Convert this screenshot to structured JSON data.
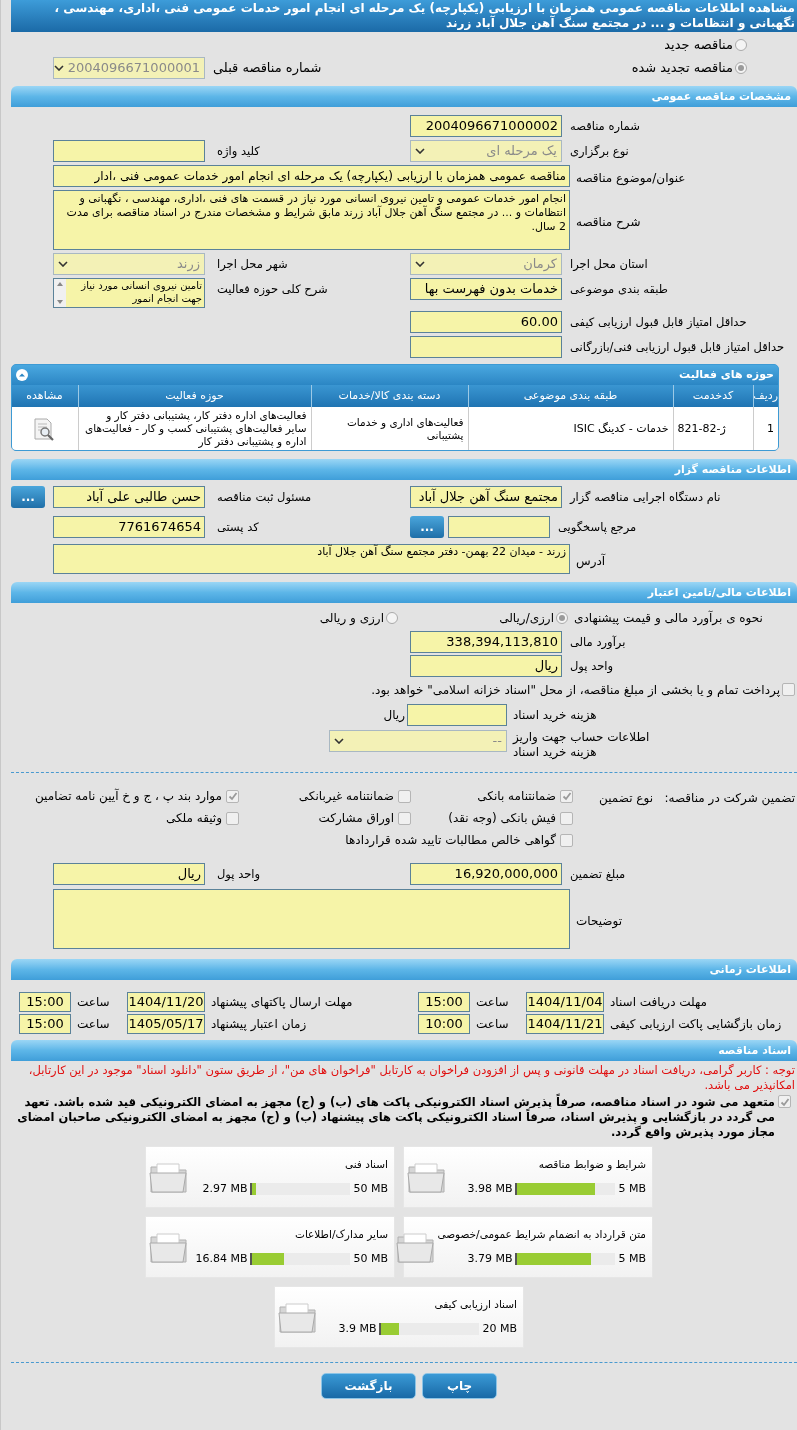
{
  "title": "مشاهده اطلاعات مناقصه عمومی همزمان با ارزیابی (یکپارچه) یک مرحله ای انجام امور خدمات عمومی فنی ،اداری، مهندسی ، نگهبانی و انتظامات و ... در مجتمع سنگ آهن جلال آباد زرند",
  "tender_type": {
    "options": [
      {
        "label": "مناقصه جدید",
        "selected": false
      },
      {
        "label": "مناقصه تجدید شده",
        "selected": true
      }
    ],
    "previous_number": {
      "label": "شماره مناقصه قبلی",
      "value": "2004096671000001",
      "kind": "select"
    }
  },
  "general": {
    "title": "مشخصات مناقصه عمومی",
    "rows": [
      [
        {
          "label": "شماره مناقصه",
          "value": "2004096671000002",
          "kind": "input"
        }
      ],
      [
        {
          "label": "نوع برگزاری",
          "value": "یک مرحله ای",
          "kind": "select"
        },
        {
          "label": "کلید واژه",
          "kind": "input"
        }
      ],
      [
        {
          "label": "عنوان/موضوع مناقصه",
          "value": "مناقصه عمومی همزمان با ارزیابی (یکپارچه) یک مرحله ای انجام امور خدمات عمومی فنی ،ادار",
          "kind": "wide_input"
        }
      ],
      [
        {
          "label": "شرح مناقصه",
          "value": "انجام امور خدمات عمومی و تامین نیروی انسانی مورد نیاز در قسمت های فنی ،اداری، مهندسی ، نگهبانی و انتظامات و ... در مجتمع سنگ آهن جلال آباد زرند مابق شرایط و مشخصات مندرج در اسناد مناقصه برای مدت 2 سال.",
          "kind": "wide_textarea"
        }
      ],
      [
        {
          "label": "استان محل اجرا",
          "value": "کرمان",
          "kind": "select"
        },
        {
          "label": "شهر محل اجرا",
          "value": "زرند",
          "kind": "select"
        }
      ],
      [
        {
          "label": "طبقه بندی موضوعی",
          "value": "خدمات بدون فهرست بها",
          "kind": "input"
        },
        {
          "label": "شرح کلی حوزه فعالیت",
          "value": "تامین نیروی انسانی مورد نیاز جهت انجام انمور",
          "kind": "scroll"
        }
      ],
      [
        {
          "label": "حداقل امتیاز قابل قبول ارزیابی کیفی",
          "value": "60.00",
          "kind": "input"
        }
      ],
      [
        {
          "label": "حداقل امتیاز قابل قبول ارزیابی فنی/بازرگانی",
          "kind": "input"
        }
      ]
    ]
  },
  "activities": {
    "title": "حوزه های فعالیت",
    "columns": [
      "ردیف",
      "کدخدمت",
      "طبقه بندی موضوعی",
      "دسته بندی کالا/خدمات",
      "حوزه فعالیت",
      "مشاهده"
    ],
    "rows": [
      [
        "1",
        "ژ-82-821",
        "خدمات - کدینگ ISIC",
        "فعالیت‌های اداری و خدمات پشتیبانی",
        "فعالیت‌های  اداره دفتر کار، پشتیبانی دفتر کار و سایر  فعالیت‌های پشتیبانی کسب و کار - فعالیت‌های  اداره و پشتیبانی دفتر کار"
      ]
    ]
  },
  "tenderer": {
    "title": "اطلاعات مناقصه گزار",
    "rows": [
      [
        {
          "label": "نام دستگاه اجرایی مناقصه گزار",
          "value": "مجتمع سنگ آهن جلال آباد",
          "kind": "input"
        },
        {
          "label": "مسئول ثبت مناقصه",
          "value": "حسن طالبی علی آباد",
          "kind": "input",
          "button": "..."
        }
      ],
      [
        {
          "label": "مرجع پاسخگویی",
          "kind": "input",
          "button": "..."
        },
        {
          "label": "کد پستی",
          "value": "7761674654",
          "kind": "input"
        }
      ],
      [
        {
          "label": "آدرس",
          "value": "زرند - میدان 22 بهمن- دفتر مجتمع سنگ آهن جلال آباد",
          "kind": "wide_short"
        }
      ]
    ]
  },
  "financial": {
    "title": "اطلاعات مالی/تامین اعتبار",
    "estimate_method": {
      "label": "نحوه ی برآورد مالی و قیمت پیشنهادی",
      "options": [
        {
          "label": "ارزی/ریالی",
          "selected": true
        },
        {
          "label": "ارزی و ریالی",
          "selected": false
        }
      ]
    },
    "rows": [
      [
        {
          "label": "برآورد مالی",
          "value": "338,394,113,810",
          "kind": "input"
        }
      ],
      [
        {
          "label": "واحد پول",
          "value": "ریال",
          "kind": "input"
        }
      ]
    ],
    "treasury": {
      "label": "پرداخت تمام و یا بخشی از مبلغ مناقصه، از محل \"اسناد خزانه اسلامی\" خواهد بود.",
      "checked": false
    },
    "doc_fee": {
      "label": "هزینه خرید اسناد",
      "suffix": "ریال"
    },
    "account": {
      "label": "اطلاعات حساب جهت واریز هزینه خرید اسناد",
      "value": "--"
    }
  },
  "guarantee": {
    "label": "تضمین شرکت در مناقصه:",
    "type_label": "نوع تضمین",
    "options": [
      {
        "label": "ضمانتنامه بانکی",
        "checked": true
      },
      {
        "label": "ضمانتنامه غیربانکی",
        "checked": false
      },
      {
        "label": "موارد بند پ ، ج و خ آیین نامه تضامین",
        "checked": true
      },
      {
        "label": "فیش بانکی (وجه نقد)",
        "checked": false
      },
      {
        "label": "اوراق مشارکت",
        "checked": false
      },
      {
        "label": "وثیقه ملکی",
        "checked": false
      },
      {
        "label": "گواهی خالص مطالبات تایید شده قراردادها",
        "checked": false
      }
    ],
    "rows": [
      [
        {
          "label": "مبلغ تضمین",
          "value": "16,920,000,000",
          "kind": "input"
        },
        {
          "label": "واحد پول",
          "value": "ریال",
          "kind": "input"
        }
      ],
      [
        {
          "label": "توضیحات",
          "kind": "wide_textarea"
        }
      ]
    ]
  },
  "timing": {
    "title": "اطلاعات زمانی",
    "items": [
      {
        "label": "مهلت دریافت اسناد",
        "date": "1404/11/04",
        "time_label": "ساعت",
        "time": "15:00"
      },
      {
        "label": "مهلت ارسال پاکتهای پیشنهاد",
        "date": "1404/11/20",
        "time_label": "ساعت",
        "time": "15:00"
      },
      {
        "label": "زمان بازگشایی پاکت ارزیابی کیفی",
        "date": "1404/11/21",
        "time_label": "ساعت",
        "time": "10:00"
      },
      {
        "label": "زمان اعتبار پیشنهاد",
        "date": "1405/05/17",
        "time_label": "ساعت",
        "time": "15:00"
      }
    ]
  },
  "documents": {
    "title": "اسناد مناقصه",
    "notice": "توجه : کاربر گرامی، دریافت اسناد در مهلت قانونی و پس از افزودن فراخوان به کارتابل \"فراخوان های من\"، از طریق ستون \"دانلود اسناد\" موجود در این کارتابل، امکانپذیر می باشد.",
    "commitment": {
      "text": "متعهد می شود در اسناد مناقصه، صرفاً پذیرش اسناد الکترونیکی پاکت های (ب) و (ج) مجهز به امضای الکترونیکی قید شده باشد. تعهد می گردد در بازگشایی و پذیرش اسناد، صرفاً اسناد الکترونیکی پاکت های پیشنهاد (ب) و (ج) مجهز به امضای الکترونیکی صاحبان امضای مجاز مورد پذیرش واقع گردد.",
      "checked": true
    },
    "files": [
      {
        "name": "شرایط و ضوابط مناقصه",
        "max": "5 MB",
        "size": "3.98 MB",
        "level": 0.8
      },
      {
        "name": "اسناد فنی",
        "max": "50 MB",
        "size": "2.97 MB",
        "level": 0.06
      },
      {
        "name": "متن قرارداد به انضمام شرایط عمومی/خصوصی",
        "max": "5 MB",
        "size": "3.79 MB",
        "level": 0.76
      },
      {
        "name": "سایر مدارک/اطلاعات",
        "max": "50 MB",
        "size": "16.84 MB",
        "level": 0.34
      },
      {
        "name": "اسناد ارزیابی کیفی",
        "max": "20 MB",
        "size": "3.9 MB",
        "level": 0.2
      }
    ]
  },
  "buttons": [
    "چاپ",
    "بازگشت"
  ]
}
